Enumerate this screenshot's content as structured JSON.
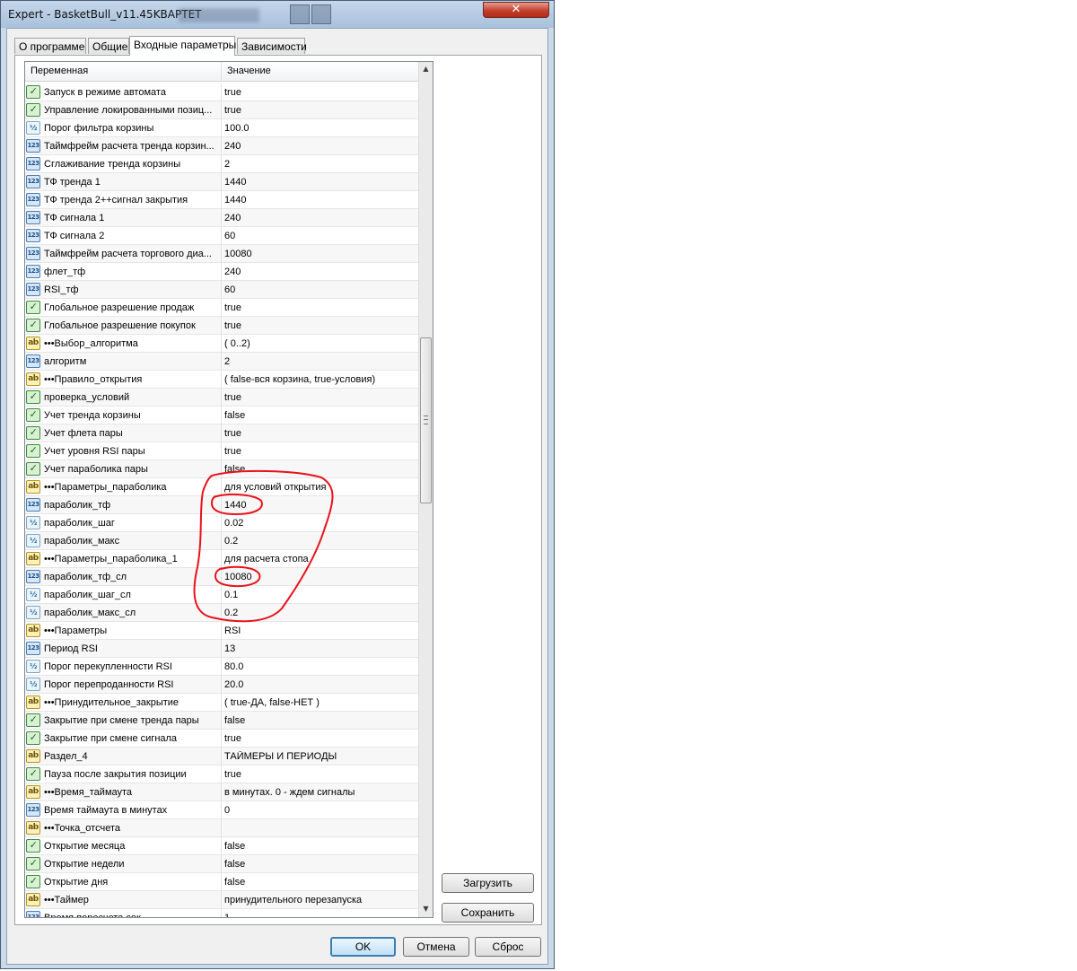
{
  "window": {
    "title": "Expert - BasketBull_v11.45KBAPTET",
    "close_glyph": "✕"
  },
  "tabs": [
    {
      "label": "О программе",
      "active": false
    },
    {
      "label": "Общие",
      "active": false
    },
    {
      "label": "Входные параметры",
      "active": true
    },
    {
      "label": "Зависимости",
      "active": false
    }
  ],
  "grid": {
    "column_variable": "Переменная",
    "column_value": "Значение"
  },
  "params": [
    {
      "icon": "bool",
      "name": "Запуск в режиме автомата",
      "value": "true"
    },
    {
      "icon": "bool",
      "name": "Управление локированными позиц...",
      "value": "true"
    },
    {
      "icon": "dbl",
      "name": "Порог фильтра корзины",
      "value": "100.0"
    },
    {
      "icon": "int",
      "name": "Таймфрейм расчета тренда корзин...",
      "value": "240"
    },
    {
      "icon": "int",
      "name": "Сглаживание тренда корзины",
      "value": "2"
    },
    {
      "icon": "int",
      "name": "ТФ тренда 1",
      "value": "1440"
    },
    {
      "icon": "int",
      "name": "ТФ тренда 2++сигнал закрытия",
      "value": "1440"
    },
    {
      "icon": "int",
      "name": "ТФ сигнала 1",
      "value": "240"
    },
    {
      "icon": "int",
      "name": "ТФ сигнала 2",
      "value": "60"
    },
    {
      "icon": "int",
      "name": "Таймфрейм расчета торгового диа...",
      "value": "10080"
    },
    {
      "icon": "int",
      "name": "флет_тф",
      "value": "240"
    },
    {
      "icon": "int",
      "name": "RSI_тф",
      "value": "60"
    },
    {
      "icon": "bool",
      "name": "Глобальное разрешение продаж",
      "value": "true"
    },
    {
      "icon": "bool",
      "name": "Глобальное разрешение покупок",
      "value": "true"
    },
    {
      "icon": "str",
      "name": "•••Выбор_алгоритма",
      "value": "( 0..2)"
    },
    {
      "icon": "int",
      "name": "алгоритм",
      "value": "2"
    },
    {
      "icon": "str",
      "name": "•••Правило_открытия",
      "value": "( false-вся корзина, true-условия)"
    },
    {
      "icon": "bool",
      "name": "проверка_условий",
      "value": "true"
    },
    {
      "icon": "bool",
      "name": "Учет тренда корзины",
      "value": "false"
    },
    {
      "icon": "bool",
      "name": "Учет флета пары",
      "value": "true"
    },
    {
      "icon": "bool",
      "name": "Учет уровня RSI пары",
      "value": "true"
    },
    {
      "icon": "bool",
      "name": "Учет параболика пары",
      "value": "false"
    },
    {
      "icon": "str",
      "name": "•••Параметры_параболика",
      "value": "для условий открытия"
    },
    {
      "icon": "int",
      "name": "параболик_тф",
      "value": "1440"
    },
    {
      "icon": "dbl",
      "name": "параболик_шаг",
      "value": "0.02"
    },
    {
      "icon": "dbl",
      "name": "параболик_макс",
      "value": "0.2"
    },
    {
      "icon": "str",
      "name": "•••Параметры_параболика_1",
      "value": "для расчета стопа"
    },
    {
      "icon": "int",
      "name": "параболик_тф_сл",
      "value": "10080"
    },
    {
      "icon": "dbl",
      "name": "параболик_шаг_сл",
      "value": "0.1"
    },
    {
      "icon": "dbl",
      "name": "параболик_макс_сл",
      "value": "0.2"
    },
    {
      "icon": "str",
      "name": "•••Параметры",
      "value": "RSI"
    },
    {
      "icon": "int",
      "name": "Период RSI",
      "value": "13"
    },
    {
      "icon": "dbl",
      "name": "Порог перекупленности RSI",
      "value": "80.0"
    },
    {
      "icon": "dbl",
      "name": "Порог перепроданности RSI",
      "value": "20.0"
    },
    {
      "icon": "str",
      "name": "•••Принудительное_закрытие",
      "value": "( true-ДА, false-НЕТ )"
    },
    {
      "icon": "bool",
      "name": "Закрытие при смене тренда пары",
      "value": "false"
    },
    {
      "icon": "bool",
      "name": "Закрытие при смене сигнала",
      "value": "true"
    },
    {
      "icon": "str",
      "name": "Раздел_4",
      "value": "ТАЙМЕРЫ И ПЕРИОДЫ"
    },
    {
      "icon": "bool",
      "name": "Пауза после закрытия позиции",
      "value": "true"
    },
    {
      "icon": "str",
      "name": "•••Время_таймаута",
      "value": "в минутах. 0 - ждем сигналы"
    },
    {
      "icon": "int",
      "name": "Время таймаута в минутах",
      "value": "0"
    },
    {
      "icon": "str",
      "name": "•••Точка_отсчета",
      "value": ""
    },
    {
      "icon": "bool",
      "name": "Открытие месяца",
      "value": "false"
    },
    {
      "icon": "bool",
      "name": "Открытие недели",
      "value": "false"
    },
    {
      "icon": "bool",
      "name": "Открытие дня",
      "value": "false"
    },
    {
      "icon": "str",
      "name": "•••Таймер",
      "value": "принудительного перезапуска"
    },
    {
      "icon": "int",
      "name": "Время пересчета сек",
      "value": "1"
    }
  ],
  "icons": {
    "bool": "✓",
    "int": "123",
    "dbl": "½",
    "str": "ab"
  },
  "buttons": {
    "load": "Загрузить",
    "save": "Сохранить",
    "ok": "OK",
    "cancel": "Отмена",
    "reset": "Сброс"
  },
  "annotation_color": "#e8121b"
}
